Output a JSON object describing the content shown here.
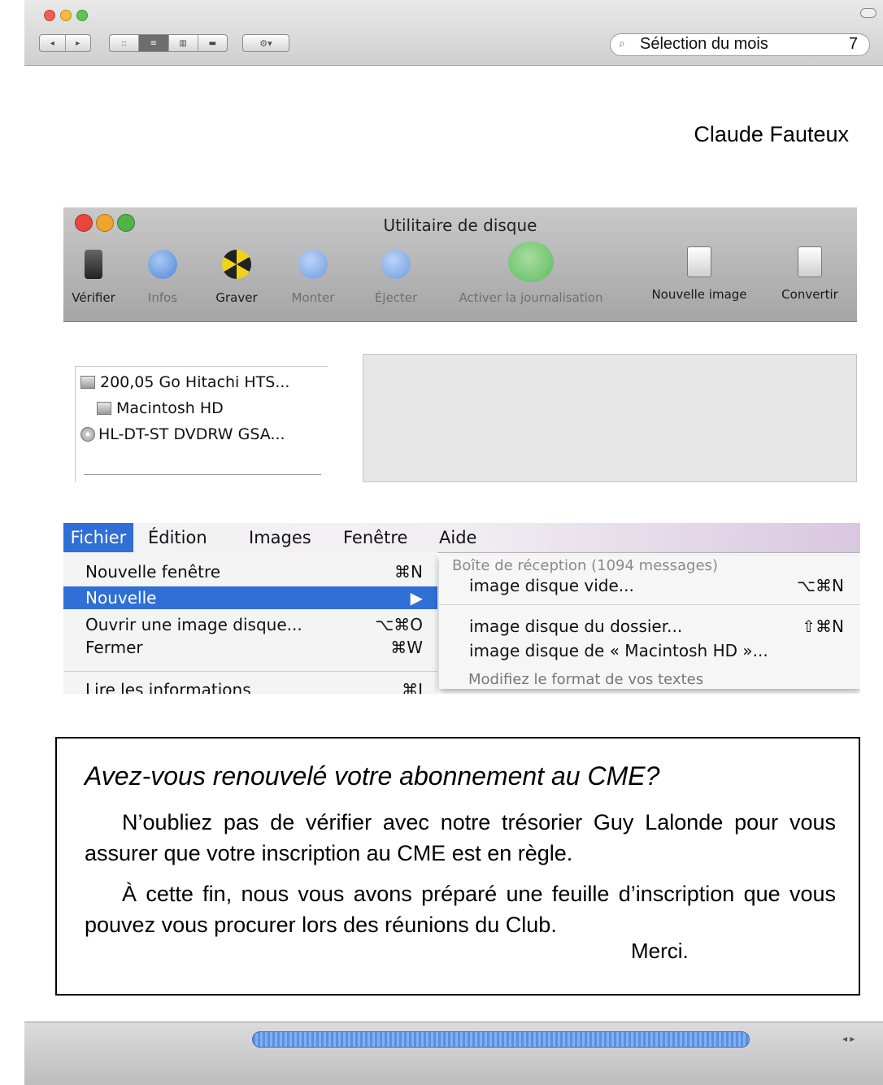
{
  "outer_window": {
    "search_text": "Sélection du mois",
    "page_number": "7",
    "toolbar": {
      "back_label": "◂",
      "forward_label": "▸",
      "view_modes": [
        "::",
        "≡",
        "▥",
        "▬"
      ],
      "active_view_mode": 1,
      "action_label": "⚙▾"
    }
  },
  "author": "Claude Fauteux",
  "disk_utility": {
    "title": "Utilitaire de disque",
    "tools": [
      {
        "label": "Vérifier",
        "icon": "microscope-icon",
        "enabled": true,
        "color": "#333333"
      },
      {
        "label": "Infos",
        "icon": "info-icon",
        "enabled": false,
        "color": "#4f86d6"
      },
      {
        "label": "Graver",
        "icon": "burn-icon",
        "enabled": true,
        "color": "#f1d21a"
      },
      {
        "label": "Monter",
        "icon": "mount-icon",
        "enabled": false,
        "color": "#6c9be3"
      },
      {
        "label": "Éjecter",
        "icon": "eject-icon",
        "enabled": false,
        "color": "#6c9be3"
      },
      {
        "label": "Activer la journalisation",
        "icon": "journaling-icon",
        "enabled": false,
        "color": "#5bbb5b"
      },
      {
        "label": "Nouvelle image",
        "icon": "new-image-icon",
        "enabled": true,
        "color": "#e8e8e8"
      },
      {
        "label": "Convertir",
        "icon": "convert-icon",
        "enabled": true,
        "color": "#e8e8e8"
      }
    ],
    "disks": [
      {
        "label": "200,05 Go Hitachi HTS...",
        "type": "disk",
        "indent": false
      },
      {
        "label": "Macintosh HD",
        "type": "volume",
        "indent": true
      },
      {
        "label": "HL-DT-ST DVDRW GSA...",
        "type": "dvd",
        "indent": false
      }
    ]
  },
  "menu": {
    "menubar": [
      "Fichier",
      "Édition",
      "Images",
      "Fenêtre",
      "Aide"
    ],
    "active": "Fichier",
    "file_items": [
      {
        "label": "Nouvelle fenêtre",
        "shortcut": "⌘N",
        "selected": false
      },
      {
        "label": "Nouvelle",
        "shortcut": "▶",
        "selected": true
      },
      {
        "label": "Ouvrir une image disque...",
        "shortcut": "⌥⌘O",
        "selected": false
      },
      {
        "label": "Fermer",
        "shortcut": "⌘W",
        "selected": false
      },
      {
        "label": "Lire les informations",
        "shortcut": "⌘I",
        "selected": false
      }
    ],
    "submenu_background_text": "Boîte de réception (1094 messages)",
    "submenu_background_text_2": "Modifiez le format de vos textes",
    "submenu_items": [
      {
        "label": "image disque vide...",
        "shortcut": "⌥⌘N"
      },
      {
        "label": "image disque du dossier...",
        "shortcut": "⇧⌘N"
      },
      {
        "label": "image disque de « Macintosh HD »...",
        "shortcut": ""
      }
    ]
  },
  "notice": {
    "title": "Avez-vous renouvelé votre abonnement au CME?",
    "paragraph1": "N’oubliez pas de vérifier avec notre trésorier Guy Lalonde pour vous assurer que votre inscription au CME est en règle.",
    "paragraph2": "À cette fin, nous vous avons préparé une feuille d’inscription que vous pouvez vous procurer lors des réunions du Club.",
    "signature": "Merci."
  },
  "scrollbar": {
    "arrows": "◂ ▸"
  }
}
